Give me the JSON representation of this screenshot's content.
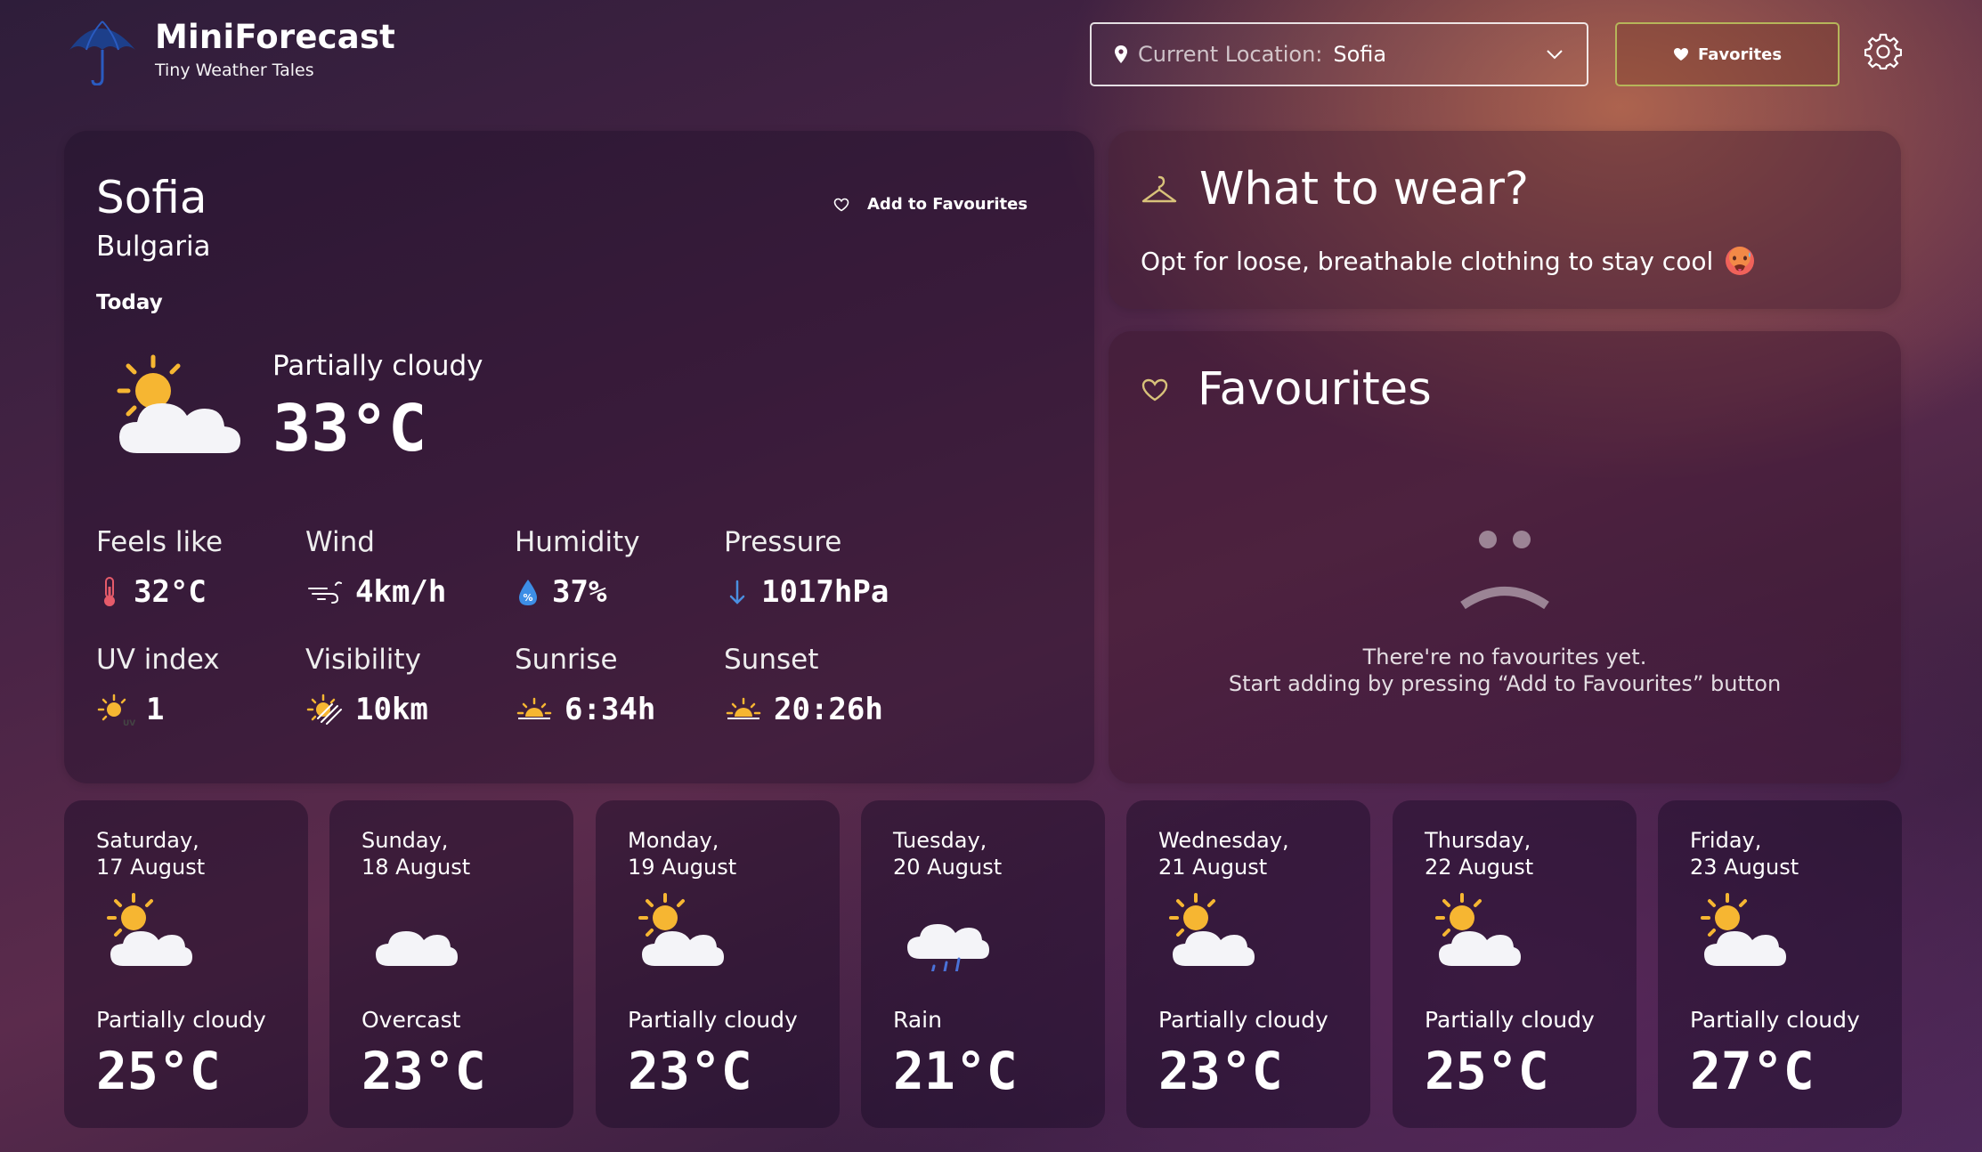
{
  "app": {
    "name": "MiniForecast",
    "tagline": "Tiny Weather Tales"
  },
  "location": {
    "label": "Current Location:",
    "value": "Sofia"
  },
  "header": {
    "favorites_label": "Favorites"
  },
  "current": {
    "city": "Sofia",
    "country": "Bulgaria",
    "day_label": "Today",
    "add_favourites_label": "Add to Favourites",
    "condition": "Partially cloudy",
    "temperature": "33°C",
    "stats": {
      "feels_like": {
        "label": "Feels like",
        "value": "32°C"
      },
      "wind": {
        "label": "Wind",
        "value": "4km/h"
      },
      "humidity": {
        "label": "Humidity",
        "value": "37%"
      },
      "pressure": {
        "label": "Pressure",
        "value": "1017hPa"
      },
      "uv": {
        "label": "UV index",
        "value": "1"
      },
      "visibility": {
        "label": "Visibility",
        "value": "10km"
      },
      "sunrise": {
        "label": "Sunrise",
        "value": "6:34h"
      },
      "sunset": {
        "label": "Sunset",
        "value": "20:26h"
      }
    }
  },
  "wear": {
    "title": "What to wear?",
    "text": "Opt for loose, breathable clothing to stay cool"
  },
  "favourites": {
    "title": "Favourites",
    "empty_line1": "There're no favourites yet.",
    "empty_line2": "Start adding by pressing “Add to Favourites” button"
  },
  "forecast": [
    {
      "day": "Saturday,",
      "date": "17 August",
      "condition": "Partially cloudy",
      "temp": "25°C",
      "icon": "partly-cloudy-icon"
    },
    {
      "day": "Sunday,",
      "date": "18 August",
      "condition": "Overcast",
      "temp": "23°C",
      "icon": "cloud-icon"
    },
    {
      "day": "Monday,",
      "date": "19 August",
      "condition": "Partially cloudy",
      "temp": "23°C",
      "icon": "partly-cloudy-icon"
    },
    {
      "day": "Tuesday,",
      "date": "20 August",
      "condition": "Rain",
      "temp": "21°C",
      "icon": "rain-icon"
    },
    {
      "day": "Wednesday,",
      "date": "21 August",
      "condition": "Partially cloudy",
      "temp": "23°C",
      "icon": "partly-cloudy-icon"
    },
    {
      "day": "Thursday,",
      "date": "22 August",
      "condition": "Partially cloudy",
      "temp": "25°C",
      "icon": "partly-cloudy-icon"
    },
    {
      "day": "Friday,",
      "date": "23 August",
      "condition": "Partially cloudy",
      "temp": "27°C",
      "icon": "partly-cloudy-icon"
    }
  ],
  "colors": {
    "accent_border": "#b6b55a",
    "sun": "#f6b632",
    "cloud": "#f4f4f8"
  }
}
